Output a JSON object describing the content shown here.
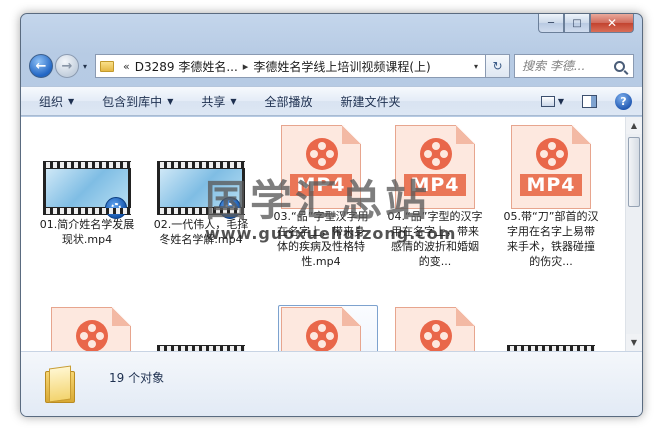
{
  "window": {
    "caption": {
      "minimize": "─",
      "maximize": "□",
      "close": "✕"
    }
  },
  "address": {
    "back_glyph": "←",
    "forward_glyph": "→",
    "chevrons": "«",
    "crumbs": [
      "D3289 李德姓名...",
      "李德姓名学线上培训视频课程(上)"
    ],
    "separator": "▸",
    "dropdown": "▾",
    "refresh_glyph": "↻",
    "search_placeholder": "搜索 李德..."
  },
  "toolbar": {
    "organize": "组织",
    "include_in_library": "包含到库中",
    "share": "共享",
    "play_all": "全部播放",
    "new_folder": "新建文件夹",
    "help_glyph": "?"
  },
  "files": [
    {
      "name": "01.简介姓名学发展现状.mp4",
      "thumb": "video"
    },
    {
      "name": "02.一代伟人，毛择冬姓名学解.mp4",
      "thumb": "video"
    },
    {
      "name": "03.“品”字型汉字用在名字上，带来身体的疾病及性格特性.mp4",
      "thumb": "mp4",
      "ext": "MP4"
    },
    {
      "name": "04.“品”字型的汉字用在名字上，带来感情的波折和婚姻的变...",
      "thumb": "mp4",
      "ext": "MP4"
    },
    {
      "name": "05.带“刀”部首的汉字用在名字上易带来手术，铁器碰撞的伤灾...",
      "thumb": "mp4",
      "ext": "MP4"
    },
    {
      "name": "",
      "thumb": "mp4"
    },
    {
      "name": "",
      "thumb": "video"
    },
    {
      "name": "",
      "thumb": "mp4"
    },
    {
      "name": "",
      "thumb": "mp4"
    },
    {
      "name": "",
      "thumb": "video"
    }
  ],
  "watermark": {
    "title": "国学汇总站",
    "url": "www.guoxuehuizong.com"
  },
  "details": {
    "count": "19 个对象"
  },
  "colors": {
    "accent": "#2266c4",
    "mp4_red": "#e9674a"
  }
}
